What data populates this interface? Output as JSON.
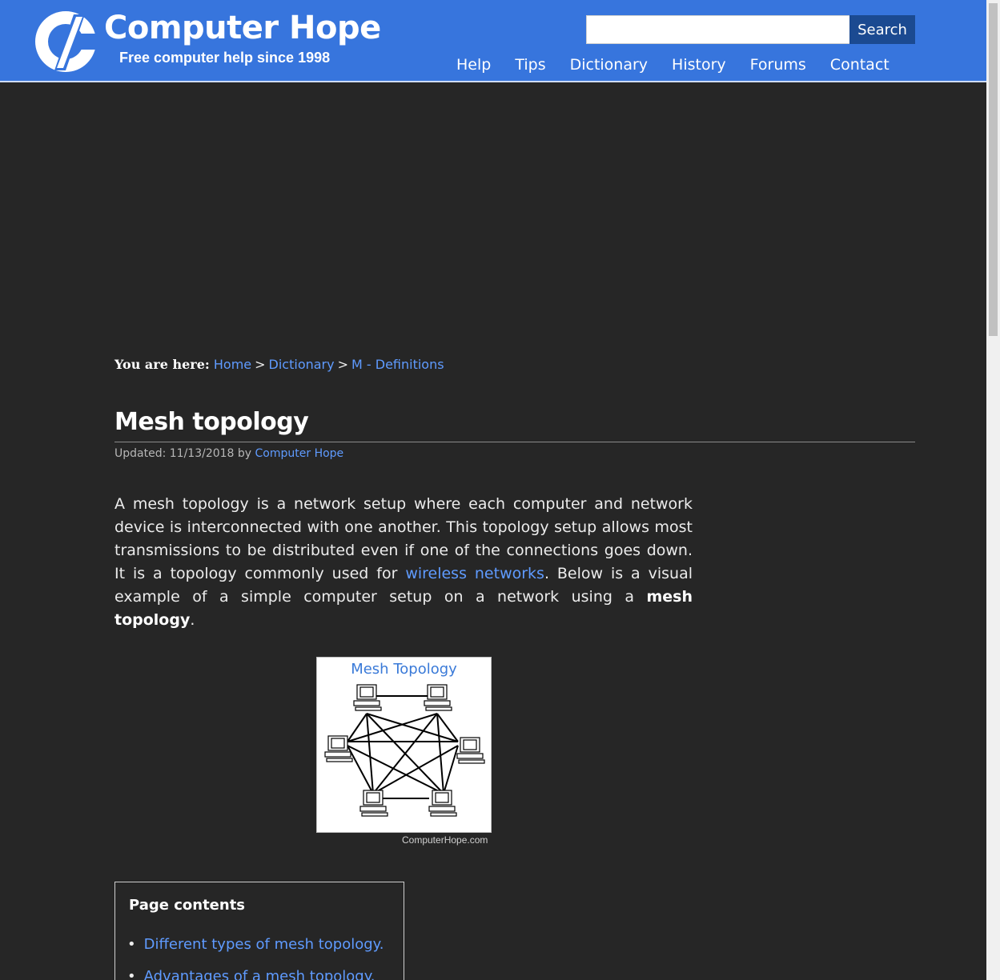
{
  "header": {
    "brand_title": "Computer Hope",
    "brand_tagline": "Free computer help since 1998",
    "search_placeholder": "",
    "search_button": "Search",
    "nav": [
      "Help",
      "Tips",
      "Dictionary",
      "History",
      "Forums",
      "Contact"
    ]
  },
  "breadcrumb": {
    "label": "You are here:",
    "items": [
      "Home",
      "Dictionary",
      "M - Definitions"
    ],
    "separator": ">"
  },
  "article": {
    "title": "Mesh topology",
    "updated_label": "Updated: 11/13/2018 by",
    "author": "Computer Hope",
    "intro_1": "A mesh topology is a network setup where each computer and network device is interconnected with one another. This topology setup allows most transmissions to be distributed even if one of the connections goes down. It is a topology commonly used for",
    "intro_link": "wireless networks",
    "intro_2": ". Below is a visual example of a simple computer setup on a network using a",
    "intro_bold": "mesh topology",
    "intro_end": "."
  },
  "figure": {
    "title": "Mesh Topology",
    "credit": "ComputerHope.com"
  },
  "toc": {
    "title": "Page contents",
    "items": [
      "Different types of mesh topology.",
      "Advantages of a mesh topology."
    ]
  },
  "colors": {
    "header_bg": "#3775dd",
    "page_bg": "#262626",
    "link": "#5f9bff",
    "search_button_bg": "#1b4a91"
  }
}
